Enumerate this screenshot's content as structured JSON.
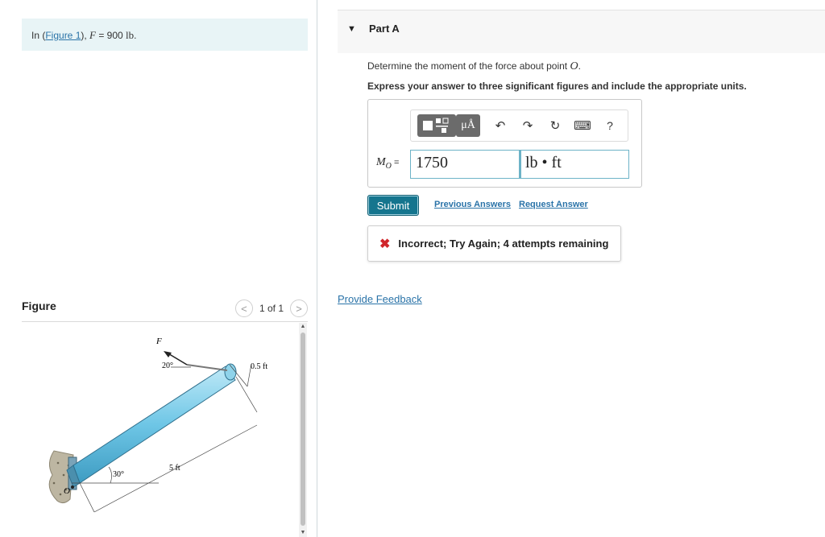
{
  "problem": {
    "prefix": "In (",
    "figure_link": "Figure 1",
    "middle": "), ",
    "var": "F",
    "eq": " = 900 ",
    "unit": "lb",
    "suffix": "."
  },
  "figure_panel": {
    "title": "Figure",
    "pager": "1 of 1",
    "prev_icon": "<",
    "next_icon": ">",
    "labels": {
      "force": "F",
      "angle_top": "20°",
      "offset": "0.5 ft",
      "length": "5 ft",
      "angle_base": "30°",
      "origin": "O"
    }
  },
  "part": {
    "caret": "▼",
    "title": "Part A",
    "question_text": "Determine the moment of the force about point ",
    "question_point": "O",
    "question_end": ".",
    "instruction": "Express your answer to three significant figures and include the appropriate units."
  },
  "toolbar": {
    "template_icon": "template-icon",
    "unit_icon_label": "μÅ",
    "undo_icon": "↶",
    "redo_icon": "↷",
    "reset_icon": "↻",
    "keyboard_icon": "⌨",
    "help_icon": "?"
  },
  "answer": {
    "label_var": "M",
    "label_sub": "O",
    "label_eq": " =",
    "value": "1750",
    "unit": "lb • ft"
  },
  "actions": {
    "submit": "Submit",
    "previous_answers": "Previous Answers",
    "request_answer": "Request Answer"
  },
  "feedback": {
    "icon": "✖",
    "message": "Incorrect; Try Again; 4 attempts remaining"
  },
  "provide_feedback": "Provide Feedback",
  "colors": {
    "accent": "#15758e",
    "link": "#2a73a8",
    "error": "#d0262b",
    "problem_bg": "#e8f4f6",
    "beam": "#6ec6e6"
  }
}
